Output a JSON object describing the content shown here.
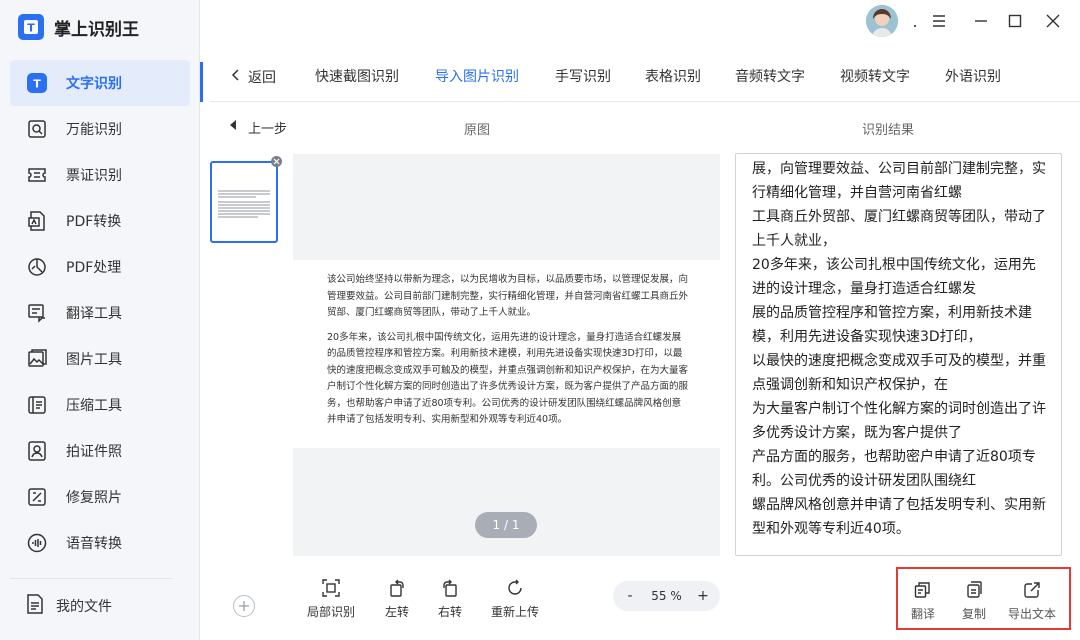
{
  "app": {
    "title": "掌上识别王",
    "logo_glyph": "T"
  },
  "sidebar": {
    "items": [
      {
        "label": "文字识别",
        "icon": "text-recognition-icon"
      },
      {
        "label": "万能识别",
        "icon": "universal-scan-icon"
      },
      {
        "label": "票证识别",
        "icon": "ticket-icon"
      },
      {
        "label": "PDF转换",
        "icon": "pdf-convert-icon"
      },
      {
        "label": "PDF处理",
        "icon": "pdf-process-icon"
      },
      {
        "label": "翻译工具",
        "icon": "translate-icon"
      },
      {
        "label": "图片工具",
        "icon": "image-tool-icon"
      },
      {
        "label": "压缩工具",
        "icon": "compress-icon"
      },
      {
        "label": "拍证件照",
        "icon": "id-photo-icon"
      },
      {
        "label": "修复照片",
        "icon": "repair-photo-icon"
      },
      {
        "label": "语音转换",
        "icon": "voice-convert-icon"
      }
    ],
    "active_index": 0,
    "my_files": "我的文件"
  },
  "titlebar": {
    "dot": "."
  },
  "tabs": {
    "back": "返回",
    "items": [
      "快速截图识别",
      "导入图片识别",
      "手写识别",
      "表格识别",
      "音频转文字",
      "视频转文字",
      "外语识别"
    ],
    "active_index": 1
  },
  "subheader": {
    "prev_step": "上一步",
    "original_title": "原图",
    "result_title": "识别结果"
  },
  "original": {
    "paragraphs": [
      "该公司始终坚持以带新为理念，以为民增收为目标，以品质要市场，以管理促发展，向管理要效益。公司目前部门建制完整，实行精细化管理，并自营河南省红螺工具商丘外贸部、厦门红螺商贸等团队，带动了上千人就业。",
      "20多年来，该公司扎根中国传统文化，运用先进的设计理念，量身打造适合红螺发展的品质管控程序和管控方案。利用新技术建模，利用先进设备实现快速3D打印，以最快的速度把概念变成双手可触及的模型，并重点强调创新和知识产权保护，在为大量客户制订个性化解方案的同时创造出了许多优秀设计方案，既为客户提供了产品方面的服务，也帮助客户申请了近80项专利。公司优秀的设计研发团队围绕红螺品牌风格创意并申请了包括发明专利、实用新型和外观等专利近40项。"
    ],
    "page_indicator": "1 / 1"
  },
  "result": {
    "lines": [
      "展，向管理要效益、公司目前部门建制完整，实",
      "行精细化管理，并自营河南省红螺",
      "工具商丘外贸部、厦门红螺商贸等团队，带动了",
      "上千人就业，",
      "20多年来，该公司扎根中国传统文化，运用先",
      "进的设计理念，量身打造适合红螺发",
      "展的品质管控程序和管控方案，利用新技术建",
      "模，利用先进设备实现快速3D打印，",
      "以最快的速度把概念变成双手可及的模型，并重",
      "点强调创新和知识产权保护，在",
      "为大量客户制订个性化解方案的词时创造出了许",
      "多优秀设计方案，既为客户提供了",
      "产品方面的服务，也帮助密户申请了近80项专",
      "利。公司优秀的设计研发团队围绕红",
      "螺品牌风格创意并申请了包括发明专利、实用新",
      "型和外观等专利近40项。"
    ]
  },
  "toolbar": {
    "partial": "局部识别",
    "rotate_left": "左转",
    "rotate_right": "右转",
    "reupload": "重新上传",
    "zoom_minus": "-",
    "zoom_value": "55 %",
    "zoom_plus": "+",
    "translate": "翻译",
    "copy": "复制",
    "export": "导出文本"
  },
  "colors": {
    "accent": "#2b6ff2",
    "highlight_border": "#e53935",
    "active_bg": "#e4ecfb"
  }
}
